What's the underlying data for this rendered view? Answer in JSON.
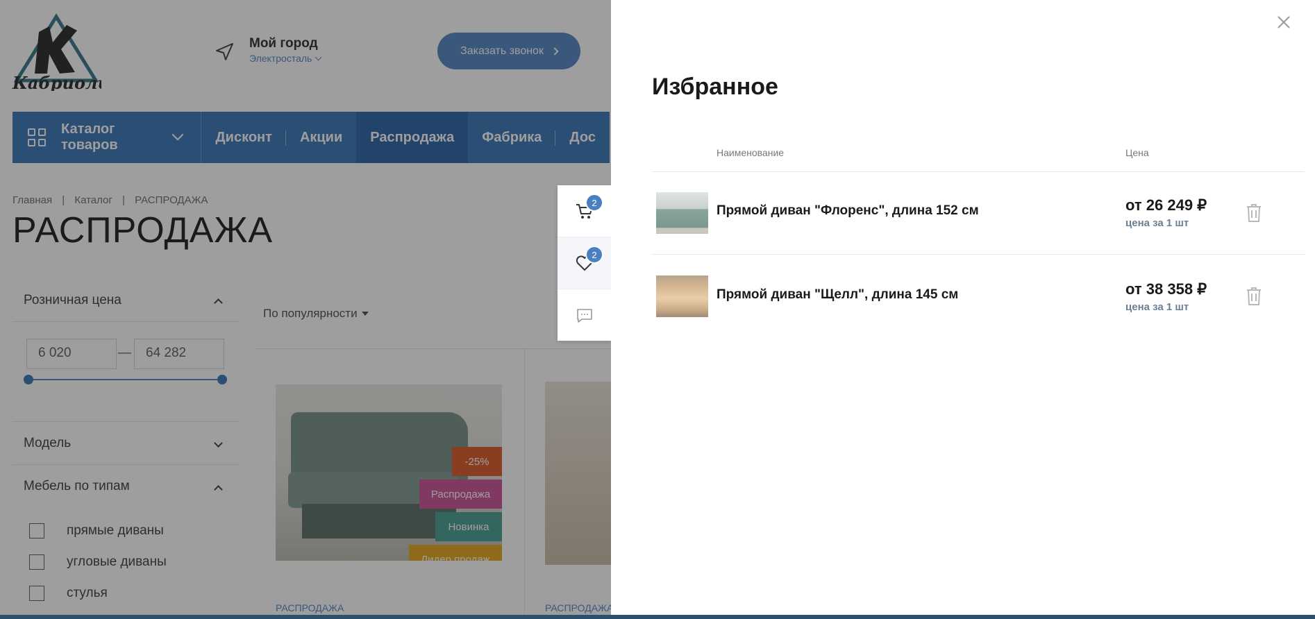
{
  "header": {
    "logo_text": "Кабриоль",
    "city_title": "Мой город",
    "city_name": "Электросталь",
    "callback_label": "Заказать звонок"
  },
  "nav": {
    "catalog_label": "Каталог товаров",
    "links": [
      "Дисконт",
      "Акции",
      "Распродажа",
      "Фабрика",
      "Дос"
    ]
  },
  "breadcrumb": [
    "Главная",
    "|",
    "Каталог",
    "|",
    "РАСПРОДАЖА"
  ],
  "page_title": "РАСПРОДАЖА",
  "filters": {
    "price_label": "Розничная цена",
    "price_min": "6 020",
    "price_max": "64 282",
    "dash": "—",
    "model_label": "Модель",
    "types_label": "Мебель по типам",
    "type_options": [
      "прямые диваны",
      "угловые диваны",
      "стулья"
    ]
  },
  "products": {
    "sort_label": "По популярности",
    "badges": [
      "-25%",
      "Распродажа",
      "Новинка",
      "Лидер продаж"
    ],
    "badge_colors": [
      "#d9501d",
      "#c9488e",
      "#3b9a8d",
      "#e0a20f"
    ],
    "category": "РАСПРОДАЖА"
  },
  "side_widget": {
    "cart_count": "2",
    "favorites_count": "2"
  },
  "favorites": {
    "title": "Избранное",
    "col_name": "Наименование",
    "col_price": "Цена",
    "items": [
      {
        "name": "Прямой диван \"Флоренс\", длина 152 см",
        "price": "от 26 249 ₽",
        "unit": "цена за 1 шт"
      },
      {
        "name": "Прямой диван \"Щелл\", длина 145 см",
        "price": "от 38 358 ₽",
        "unit": "цена за 1 шт"
      }
    ]
  },
  "colors": {
    "accent": "#2f6db5",
    "accent_light": "#4a7fc1",
    "overlay": "rgba(40,40,40,0.45)"
  }
}
